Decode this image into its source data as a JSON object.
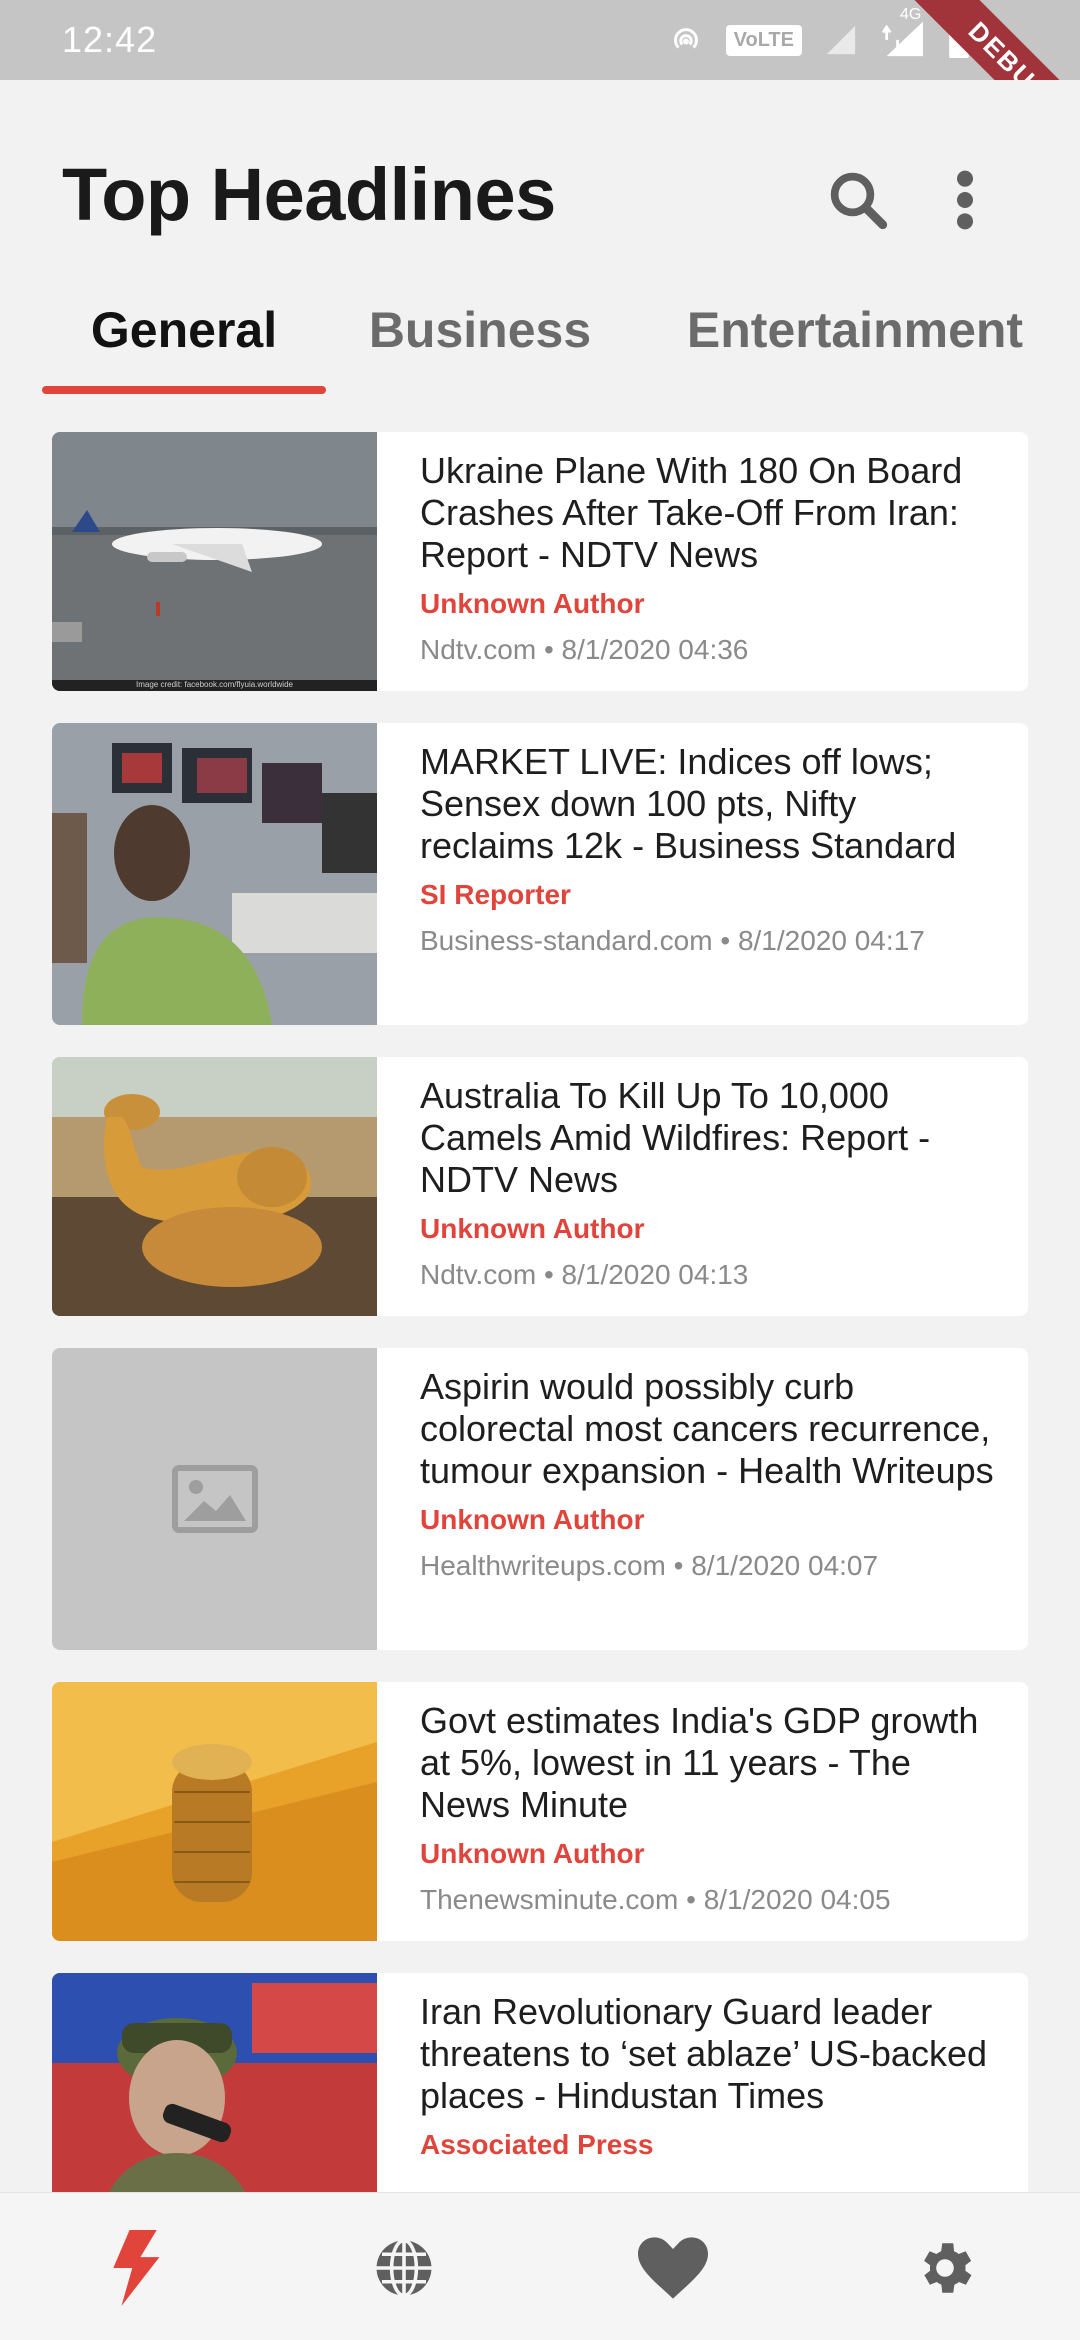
{
  "status_bar": {
    "time": "12:42",
    "volte": "VoLTE",
    "network": "4G",
    "debug": "DEBUG"
  },
  "header": {
    "title": "Top Headlines",
    "search_icon": "search-icon",
    "more_icon": "more-vert-icon"
  },
  "tabs": [
    {
      "label": "General",
      "active": true
    },
    {
      "label": "Business",
      "active": false
    },
    {
      "label": "Entertainment",
      "active": false
    }
  ],
  "articles": [
    {
      "title": "Ukraine Plane With 180 On Board Crashes After Take-Off From Iran: Report - NDTV News",
      "author": "Unknown Author",
      "meta": "Ndtv.com • 8/1/2020 04:36",
      "image": "plane-photo",
      "image_caption": "Image credit: facebook.com/flyuia.worldwide"
    },
    {
      "title": "MARKET LIVE: Indices off lows; Sensex down 100 pts, Nifty reclaims 12k - Business Standard",
      "author": "SI Reporter",
      "meta": "Business-standard.com • 8/1/2020 04:17",
      "image": "trader-photo"
    },
    {
      "title": "Australia To Kill Up To 10,000 Camels Amid Wildfires: Report - NDTV News",
      "author": "Unknown Author",
      "meta": "Ndtv.com • 8/1/2020 04:13",
      "image": "camels-photo"
    },
    {
      "title": "Aspirin would possibly curb colorectal most cancers recurrence, tumour expansion - Health Writeups",
      "author": "Unknown Author",
      "meta": "Healthwriteups.com • 8/1/2020 04:07",
      "image": "placeholder-image-icon"
    },
    {
      "title": "Govt estimates India's GDP growth at 5%, lowest in 11 years - The News Minute",
      "author": "Unknown Author",
      "meta": "Thenewsminute.com • 8/1/2020 04:05",
      "image": "coins-photo"
    },
    {
      "title": "Iran Revolutionary Guard leader threatens to ‘set ablaze’ US-backed places - Hindustan Times",
      "author": "Associated Press",
      "meta": "",
      "image": "general-photo"
    }
  ],
  "bottom_nav": [
    {
      "icon": "flash-icon",
      "active": true
    },
    {
      "icon": "globe-icon",
      "active": false
    },
    {
      "icon": "heart-icon",
      "active": false
    },
    {
      "icon": "settings-icon",
      "active": false
    }
  ],
  "colors": {
    "accent": "#e0443a",
    "text": "#1e1e1e",
    "meta": "#8a8a8a",
    "icon": "#5f5f5f"
  }
}
